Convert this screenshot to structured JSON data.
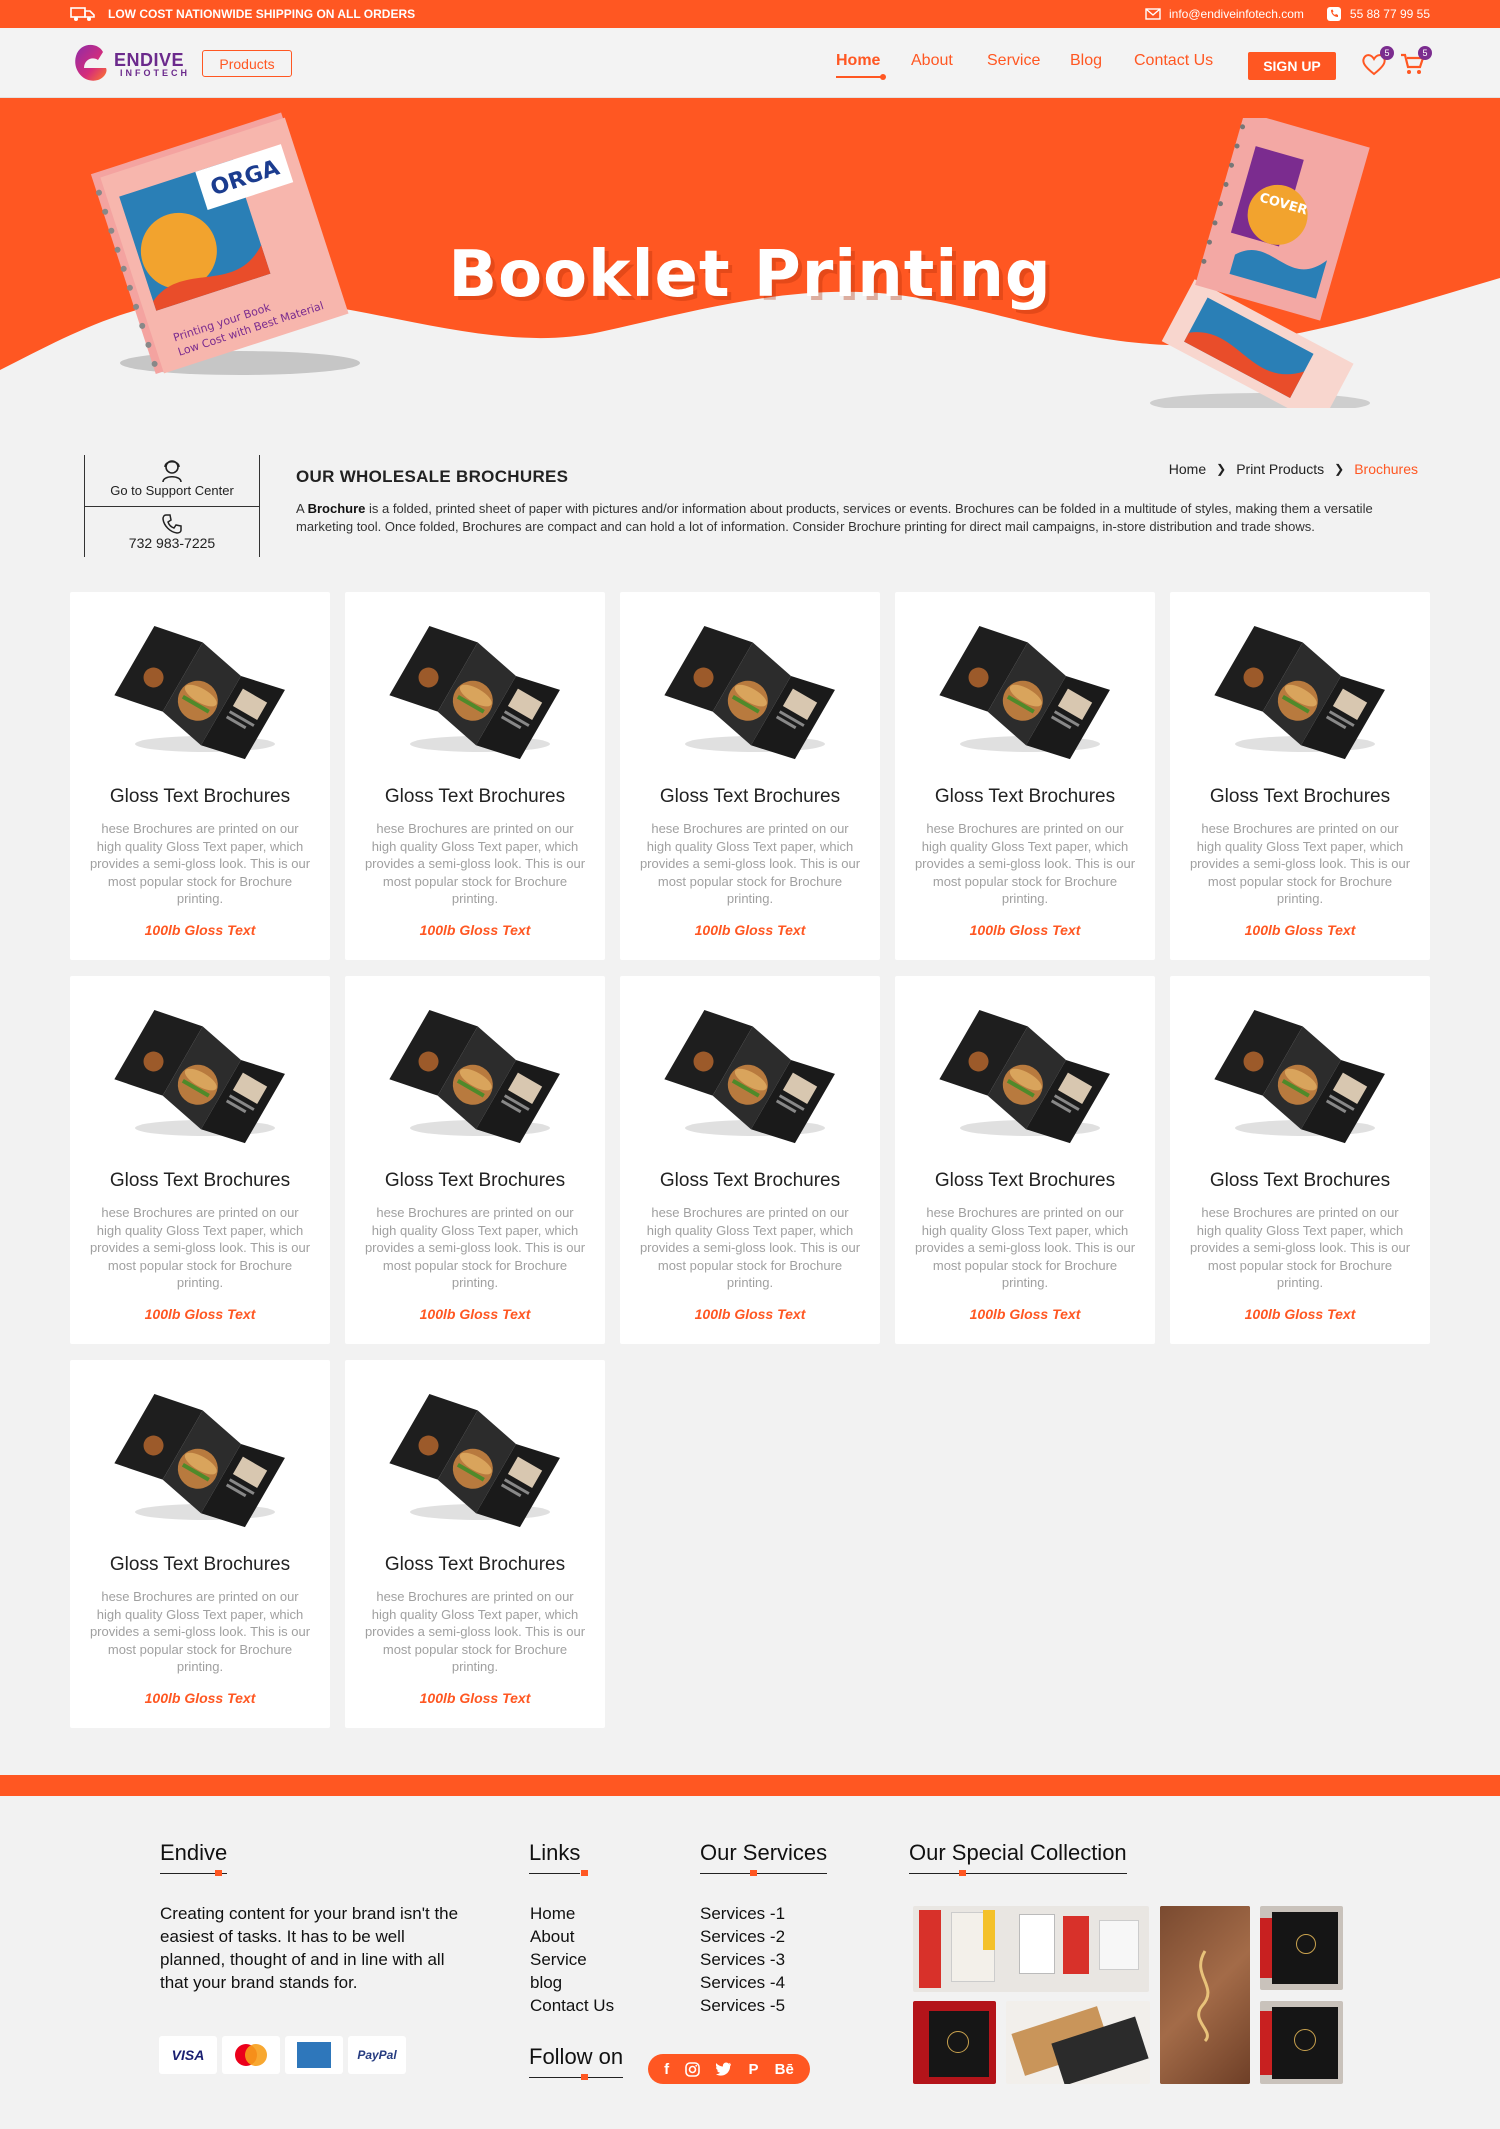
{
  "topbar": {
    "shipping": "LOW COST NATIONWIDE SHIPPING ON ALL ORDERS",
    "email": "info@endiveinfotech.com",
    "phone": "55 88 77 99 55"
  },
  "brand": {
    "line1": "ENDIVE",
    "line2": "INFOTECH"
  },
  "header": {
    "products_label": "Products",
    "nav": [
      "Home",
      "About",
      "Service",
      "Blog",
      "Contact Us"
    ],
    "signup_label": "SIGN UP",
    "wishlist_count": "5",
    "cart_count": "5"
  },
  "hero": {
    "title": "Booklet Printing"
  },
  "support": {
    "label": "Go to Support Center",
    "phone": "732 983-7225"
  },
  "section": {
    "title": "OUR WHOLESALE BROCHURES",
    "desc_bold": "Brochure",
    "desc_pre": "A ",
    "desc_rest": " is a folded, printed sheet of paper with pictures and/or information about products, services or events. Brochures can be folded in a multitude of styles, making them a versatile marketing tool. Once folded, Brochures are compact and can hold a lot of information. Consider Brochure printing for direct mail campaigns, in-store distribution and trade shows."
  },
  "breadcrumb": [
    "Home",
    "Print Products",
    "Brochures"
  ],
  "products": [
    {
      "title": "Gloss Text Brochures",
      "desc": "hese Brochures are printed on our high quality Gloss Text paper, which provides a semi-gloss look. This is our most popular stock for Brochure printing.",
      "stock": "100lb Gloss Text"
    },
    {
      "title": "Gloss Text Brochures",
      "desc": "hese Brochures are printed on our high quality Gloss Text paper, which provides a semi-gloss look. This is our most popular stock for Brochure printing.",
      "stock": "100lb Gloss Text"
    },
    {
      "title": "Gloss Text Brochures",
      "desc": "hese Brochures are printed on our high quality Gloss Text paper, which provides a semi-gloss look. This is our most popular stock for Brochure printing.",
      "stock": "100lb Gloss Text"
    },
    {
      "title": "Gloss Text Brochures",
      "desc": "hese Brochures are printed on our high quality Gloss Text paper, which provides a semi-gloss look. This is our most popular stock for Brochure printing.",
      "stock": "100lb Gloss Text"
    },
    {
      "title": "Gloss Text Brochures",
      "desc": "hese Brochures are printed on our high quality Gloss Text paper, which provides a semi-gloss look. This is our most popular stock for Brochure printing.",
      "stock": "100lb Gloss Text"
    },
    {
      "title": "Gloss Text Brochures",
      "desc": "hese Brochures are printed on our high quality Gloss Text paper, which provides a semi-gloss look. This is our most popular stock for Brochure printing.",
      "stock": "100lb Gloss Text"
    },
    {
      "title": "Gloss Text Brochures",
      "desc": "hese Brochures are printed on our high quality Gloss Text paper, which provides a semi-gloss look. This is our most popular stock for Brochure printing.",
      "stock": "100lb Gloss Text"
    },
    {
      "title": "Gloss Text Brochures",
      "desc": "hese Brochures are printed on our high quality Gloss Text paper, which provides a semi-gloss look. This is our most popular stock for Brochure printing.",
      "stock": "100lb Gloss Text"
    },
    {
      "title": "Gloss Text Brochures",
      "desc": "hese Brochures are printed on our high quality Gloss Text paper, which provides a semi-gloss look. This is our most popular stock for Brochure printing.",
      "stock": "100lb Gloss Text"
    },
    {
      "title": "Gloss Text Brochures",
      "desc": "hese Brochures are printed on our high quality Gloss Text paper, which provides a semi-gloss look. This is our most popular stock for Brochure printing.",
      "stock": "100lb Gloss Text"
    },
    {
      "title": "Gloss Text Brochures",
      "desc": "hese Brochures are printed on our high quality Gloss Text paper, which provides a semi-gloss look. This is our most popular stock for Brochure printing.",
      "stock": "100lb Gloss Text"
    },
    {
      "title": "Gloss Text Brochures",
      "desc": "hese Brochures are printed on our high quality Gloss Text paper, which provides a semi-gloss look. This is our most popular stock for Brochure printing.",
      "stock": "100lb Gloss Text"
    }
  ],
  "footer": {
    "about_title": "Endive",
    "about_text": "Creating content for your brand isn't the easiest of tasks. It has to be well planned, thought of and in line with all that your brand stands for.",
    "payments": [
      "VISA",
      "MasterCard",
      "AMEX",
      "PayPal"
    ],
    "links_title": "Links",
    "links": [
      "Home",
      "About",
      "Service",
      "blog",
      "Contact Us"
    ],
    "services_title": "Our Services",
    "services": [
      "Services -1",
      "Services -2",
      "Services -3",
      "Services -4",
      "Services -5"
    ],
    "collection_title": "Our Special Collection",
    "follow_title": "Follow on",
    "social": [
      "f",
      "ig",
      "tw",
      "P",
      "Bē"
    ]
  },
  "colors": {
    "accent": "#ff5722",
    "brand_purple": "#7b2c8f",
    "bg": "#f2f2f2"
  }
}
